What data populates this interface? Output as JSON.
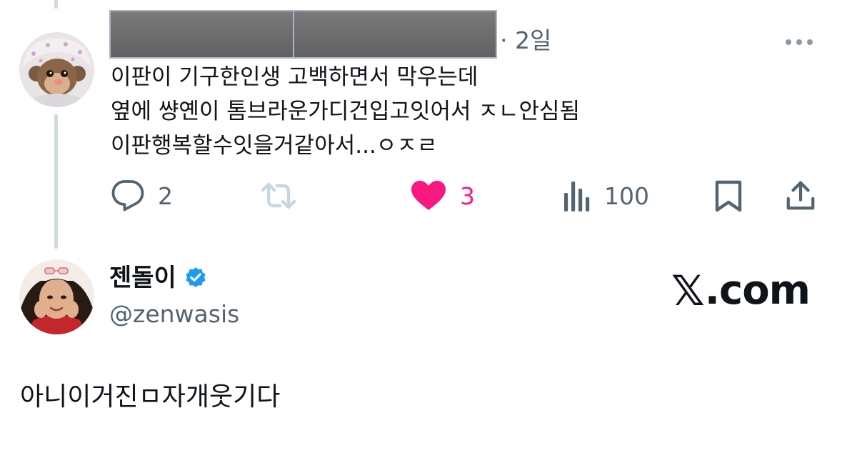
{
  "reply": {
    "time": "· 2일",
    "lines": [
      "이판이 기구한인생 고백하면서 막우는데",
      "옆에 썅옌이 톰브라운가디건입고잇어서 ㅈㄴ안심됨",
      "이판행복할수잇을거같아서...ㅇㅈㄹ"
    ],
    "actions": {
      "replies": "2",
      "reposts": "",
      "likes": "3",
      "views": "100"
    }
  },
  "main": {
    "name": "젠돌이",
    "handle": "@zenwasis",
    "verified": true,
    "text": "아니이거진ㅁ자개웃기다"
  },
  "brand": {
    "x_glyph": "𝕏",
    "domain": ".com"
  },
  "colors": {
    "text": "#0f1419",
    "secondary": "#536471",
    "like": "#f91880",
    "verified": "#1d9bf0",
    "thread_line": "#cfd9de"
  },
  "icons": [
    "reply-icon",
    "repost-icon",
    "heart-icon",
    "views-icon",
    "bookmark-icon",
    "share-icon",
    "more-icon",
    "verified-badge-icon"
  ]
}
